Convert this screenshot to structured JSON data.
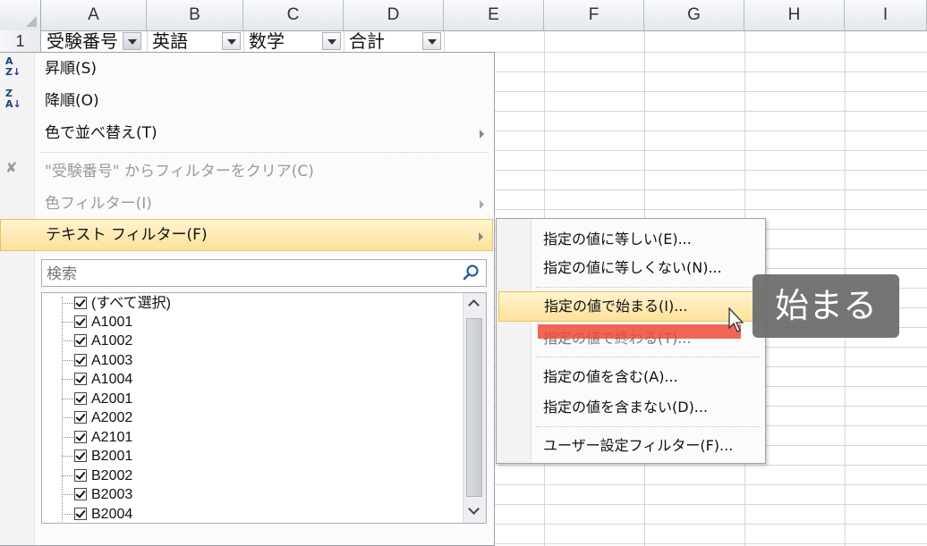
{
  "columns": [
    "A",
    "B",
    "C",
    "D",
    "E",
    "F",
    "G",
    "H",
    "I"
  ],
  "row1_label": "1",
  "headers": {
    "a": "受験番号",
    "b": "英語",
    "c": "数学",
    "d": "合計"
  },
  "menu": {
    "sort_asc": "昇順(S)",
    "sort_desc": "降順(O)",
    "sort_by_color": "色で並べ替え(T)",
    "clear_filter": "\"受験番号\" からフィルターをクリア(C)",
    "color_filter": "色フィルター(I)",
    "text_filter": "テキスト フィルター(F)"
  },
  "search": {
    "placeholder": "検索"
  },
  "list": {
    "select_all": "(すべて選択)",
    "items": [
      "A1001",
      "A1002",
      "A1003",
      "A1004",
      "A2001",
      "A2002",
      "A2101",
      "B2001",
      "B2002",
      "B2003",
      "B2004"
    ]
  },
  "submenu": {
    "equals": "指定の値に等しい(E)...",
    "not_equals": "指定の値に等しくない(N)...",
    "begins_with": "指定の値で始まる(I)...",
    "ends_with": "指定の値で終わる(T)...",
    "contains": "指定の値を含む(A)...",
    "not_contains": "指定の値を含まない(D)...",
    "custom": "ユーザー設定フィルター(F)..."
  },
  "tooltip": "始まる",
  "colors": {
    "highlight": "#fde19a",
    "annotation_bar": "#ee4a3a",
    "tooltip_bg": "#6e6e6e"
  }
}
